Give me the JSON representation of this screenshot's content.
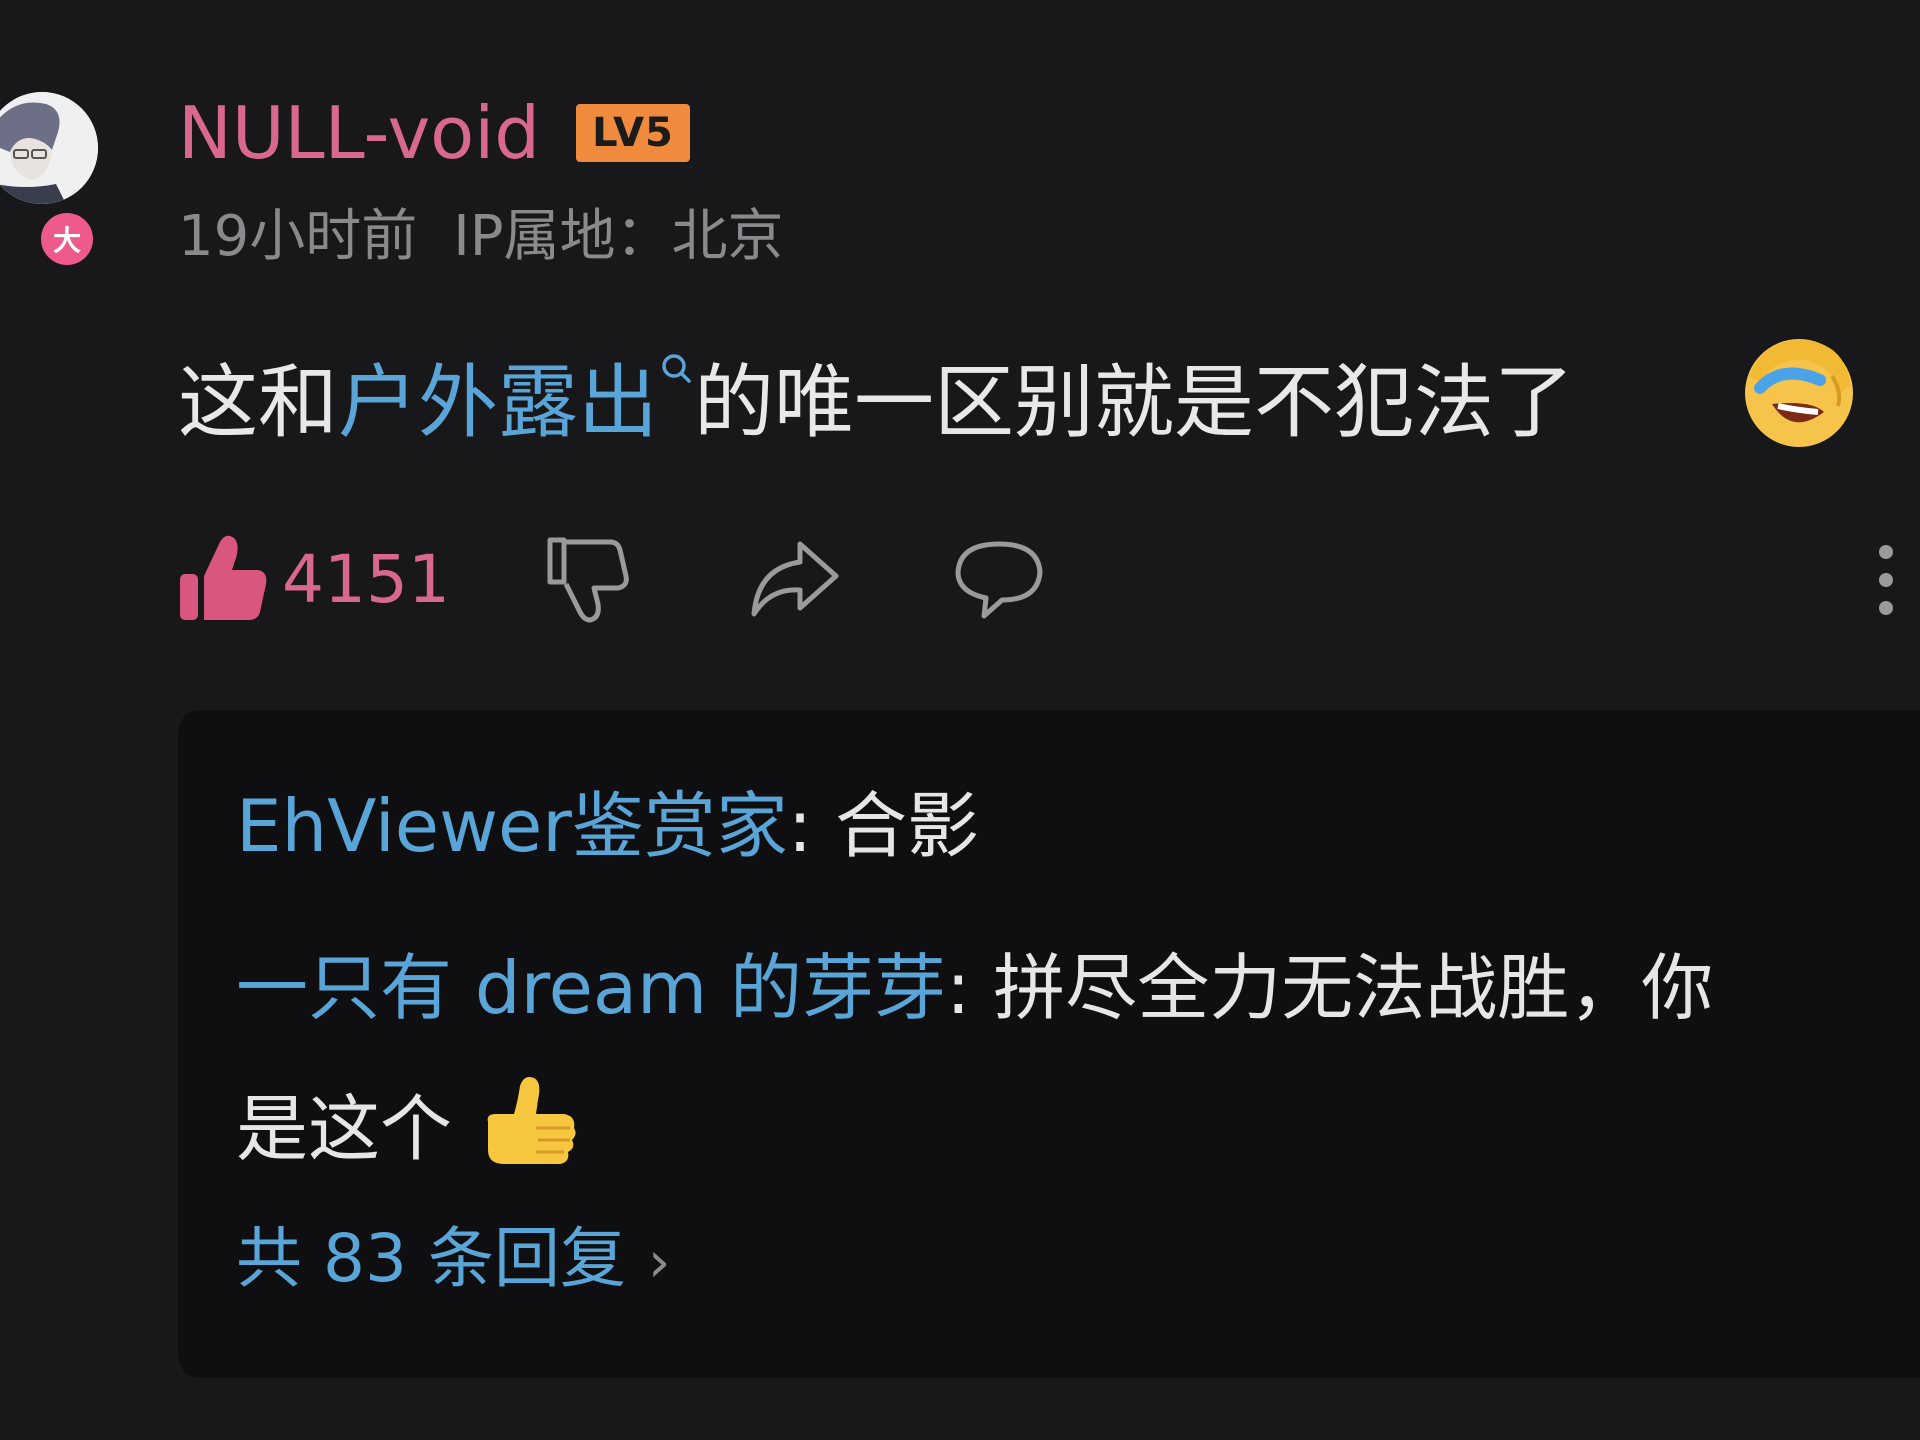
{
  "comment": {
    "username": "NULL-void",
    "level": "LV5",
    "avatar_badge": "大",
    "time": "19小时前",
    "ip_location": "IP属地：北京",
    "text_before": "这和",
    "link_text": "户外露出",
    "text_after": "的唯一区别就是不犯法了",
    "emoji": "laugh-cry-emoji",
    "like_count": "4151"
  },
  "icons": {
    "like": "thumbs-up-icon",
    "dislike": "thumbs-down-icon",
    "share": "share-icon",
    "reply": "comment-bubble-icon",
    "more": "more-vertical-icon"
  },
  "replies": [
    {
      "author": "EhViewer鉴赏家",
      "sep": ": ",
      "text": "合影"
    },
    {
      "author": "一只有 dream 的芽芽",
      "sep": ": ",
      "text": "拼尽全力无法战胜，你",
      "text_cont": "是这个"
    }
  ],
  "more_replies": "共 83 条回复",
  "colors": {
    "background": "#18181a",
    "reply_background": "#0f0f11",
    "username": "#d9688f",
    "link": "#5aa5d8",
    "meta": "#8a8a8e",
    "level_badge": "#f08a3c",
    "like_accent": "#d9688f"
  }
}
